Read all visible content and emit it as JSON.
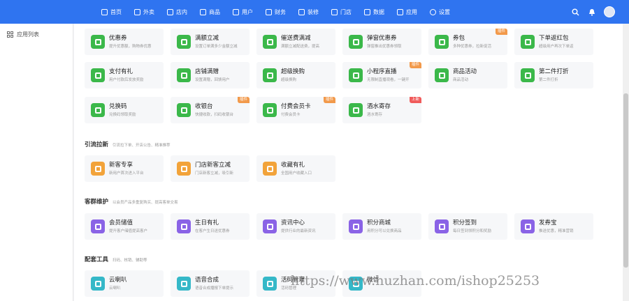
{
  "topbar": {
    "nav": [
      {
        "label": "首页"
      },
      {
        "label": "外卖"
      },
      {
        "label": "店内"
      },
      {
        "label": "商品"
      },
      {
        "label": "用户"
      },
      {
        "label": "财务"
      },
      {
        "label": "装修"
      },
      {
        "label": "门店"
      },
      {
        "label": "数据"
      },
      {
        "label": "应用"
      },
      {
        "label": "设置"
      }
    ]
  },
  "sidebar": {
    "items": [
      {
        "label": "应用列表"
      }
    ]
  },
  "colors": {
    "brand": "#2f74f0",
    "green": "#3bb84a",
    "orange": "#f2a33a",
    "purple": "#8a63e6",
    "teal": "#35b8c8",
    "badge_orange": "#f2994a",
    "badge_red": "#f05b5b"
  },
  "sections": [
    {
      "title": "引流拉新",
      "desc": "引流拉下单、开店公告、精准推荐"
    },
    {
      "title": "客群维护",
      "desc": "以会员产品多重复购买、提高客单交易"
    },
    {
      "title": "配套工具",
      "desc": "扫码、核销、辅助等"
    }
  ],
  "cards": [
    {
      "title": "优惠券",
      "desc": "提升优惠额，购物券优惠"
    },
    {
      "title": "满额立减",
      "desc": "设置订单满多少金额立减"
    },
    {
      "title": "催送费满减",
      "desc": "满额立减配送费，提高"
    },
    {
      "title": "弹窗优惠券",
      "desc": "弹窗推出优惠券领取"
    },
    {
      "title": "券包",
      "desc": "多种优惠券，拉新促活",
      "badge": "插件"
    },
    {
      "title": "下单返红包",
      "desc": "超级用户再次下单返"
    },
    {
      "title": "支付有礼",
      "desc": "用户付款后发放奖励"
    },
    {
      "title": "店铺满赠",
      "desc": "设置满赠，回馈用户"
    },
    {
      "title": "超级换购",
      "desc": "超级换购"
    },
    {
      "title": "小程序直播",
      "desc": "无限制直播观看，一键开",
      "badge": "插件"
    },
    {
      "title": "商品活动",
      "desc": "商品活动"
    },
    {
      "title": "第二件打折",
      "desc": "第二件打折"
    },
    {
      "title": "兑换码",
      "desc": "兑换码领取奖励"
    },
    {
      "title": "收银台",
      "desc": "快捷收款，扫码收银台",
      "badge": "插件"
    },
    {
      "title": "付费会员卡",
      "desc": "付费会员卡",
      "badge": "插件"
    },
    {
      "title": "酒水寄存",
      "desc": "酒水寄存",
      "badge": "上新"
    },
    {
      "title": "新客专享",
      "desc": "新用户首次进入平台"
    },
    {
      "title": "门店新客立减",
      "desc": "门店新客立减，吸引新"
    },
    {
      "title": "收藏有礼",
      "desc": "全国用户收藏入口"
    },
    {
      "title": "会员储值",
      "desc": "提升客户储值提高客户"
    },
    {
      "title": "生日有礼",
      "desc": "在客户生日送优惠券"
    },
    {
      "title": "资讯中心",
      "desc": "提供行业的最新资讯"
    },
    {
      "title": "积分商城",
      "desc": "用积分可以兑换商品"
    },
    {
      "title": "积分签到",
      "desc": "每日签到领积分和奖励"
    },
    {
      "title": "发券宝",
      "desc": "推送优惠，精准营销"
    },
    {
      "title": "云喇叭",
      "desc": "云喇叭"
    },
    {
      "title": "语音合成",
      "desc": "语音合成播报下单提示"
    },
    {
      "title": "活码管理",
      "desc": "活码管理"
    },
    {
      "title": "微信",
      "desc": ""
    }
  ],
  "watermark": "https://www.huzhan.com/ishop25253"
}
